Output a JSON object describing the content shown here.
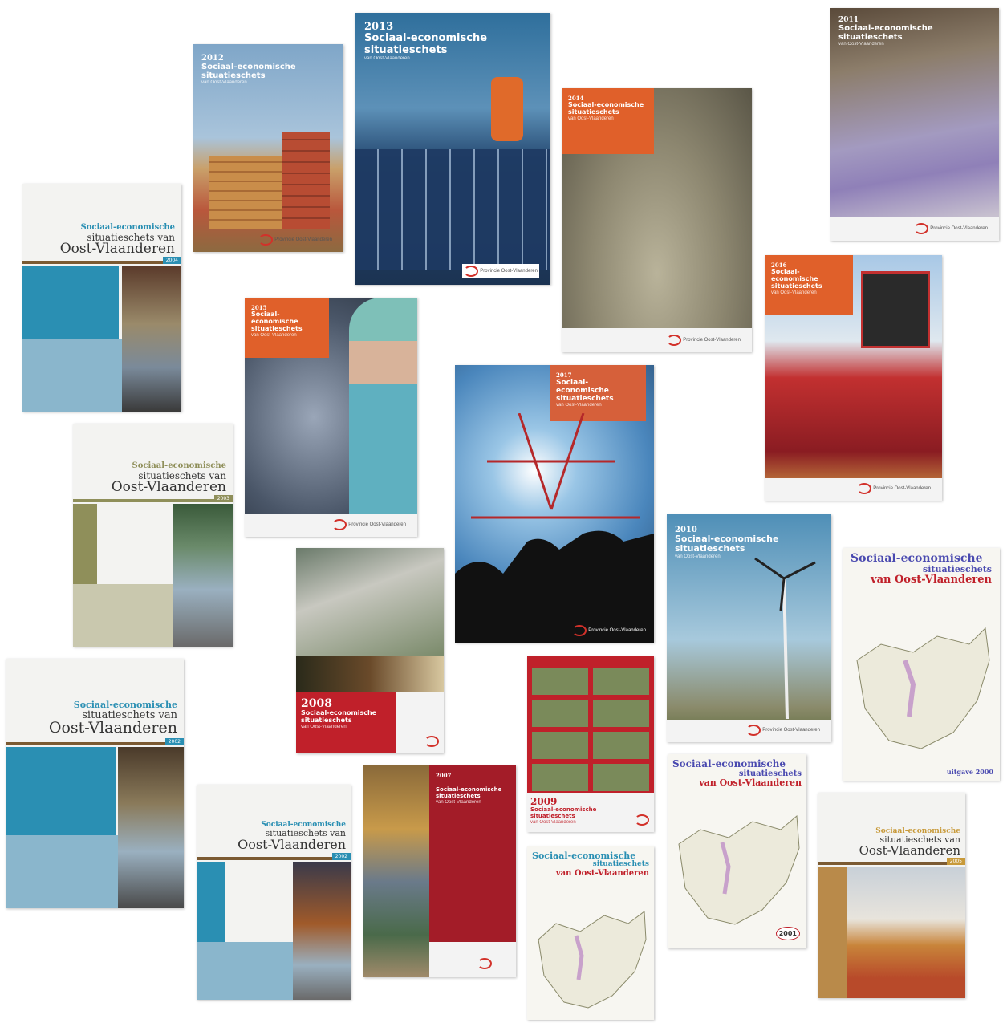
{
  "covers": {
    "c2013": {
      "year": "2013",
      "title": "Sociaal-economische situatieschets",
      "sub": "van Oost-Vlaanderen"
    },
    "c2012": {
      "year": "2012",
      "title": "Sociaal-economische situatieschets",
      "sub": "van Oost-Vlaanderen"
    },
    "c2014": {
      "year": "2014",
      "title": "Sociaal-economische situatieschets",
      "sub": "van Oost-Vlaanderen"
    },
    "c2011": {
      "year": "2011",
      "title": "Sociaal-economische situatieschets",
      "sub": "van Oost-Vlaanderen"
    },
    "c2015": {
      "year": "2015",
      "title": "Sociaal-economische situatieschets",
      "sub": "van Oost-Vlaanderen"
    },
    "c2016": {
      "year": "2016",
      "title": "Sociaal-economische situatieschets",
      "sub": "van Oost-Vlaanderen"
    },
    "c2017": {
      "year": "2017",
      "title": "Sociaal-economische situatieschets",
      "sub": "van Oost-Vlaanderen"
    },
    "c2010": {
      "year": "2010",
      "title": "Sociaal-economische situatieschets",
      "sub": "van Oost-Vlaanderen"
    },
    "c2008": {
      "year": "2008",
      "title": "Sociaal-economische situatieschets",
      "sub": "van Oost-Vlaanderen"
    },
    "c2009": {
      "year": "2009",
      "title": "Sociaal-economische situatieschets",
      "sub": "van Oost-Vlaanderen"
    },
    "c2007": {
      "year": "2007",
      "title": "Sociaal-economische situatieschets",
      "sub": "van Oost-Vlaanderen"
    },
    "old2004": {
      "l1": "Sociaal-economische",
      "l2": "situatieschets van",
      "l3": "Oost-Vlaanderen",
      "year": "2004"
    },
    "old2003": {
      "l1": "Sociaal-economische",
      "l2": "situatieschets van",
      "l3": "Oost-Vlaanderen",
      "year": "2003"
    },
    "old2002": {
      "l1": "Sociaal-economische",
      "l2": "situatieschets van",
      "l3": "Oost-Vlaanderen",
      "year": "2002"
    },
    "old2002b": {
      "l1": "Sociaal-economische",
      "l2": "situatieschets van",
      "l3": "Oost-Vlaanderen",
      "year": "2002"
    },
    "old2005": {
      "l1": "Sociaal-economische",
      "l2": "situatieschets van",
      "l3": "Oost-Vlaanderen",
      "year": "2005"
    },
    "map2000": {
      "l1": "Sociaal-economische",
      "l2": "situatieschets",
      "l3": "van Oost-Vlaanderen",
      "year": "uitgave 2000"
    },
    "map2001": {
      "l1": "Sociaal-economische",
      "l2": "situatieschets",
      "l3": "van Oost-Vlaanderen",
      "year": "2001"
    },
    "map1999": {
      "l1": "Sociaal-economische",
      "l2": "situatieschets",
      "l3": "van Oost-Vlaanderen"
    }
  },
  "logo_text": "Provincie Oost-Vlaanderen",
  "colors": {
    "orange": "#e0602a",
    "red": "#c0202a",
    "teal": "#2a8fb3",
    "olive": "#8f8f5a",
    "brown": "#7b5a32"
  }
}
